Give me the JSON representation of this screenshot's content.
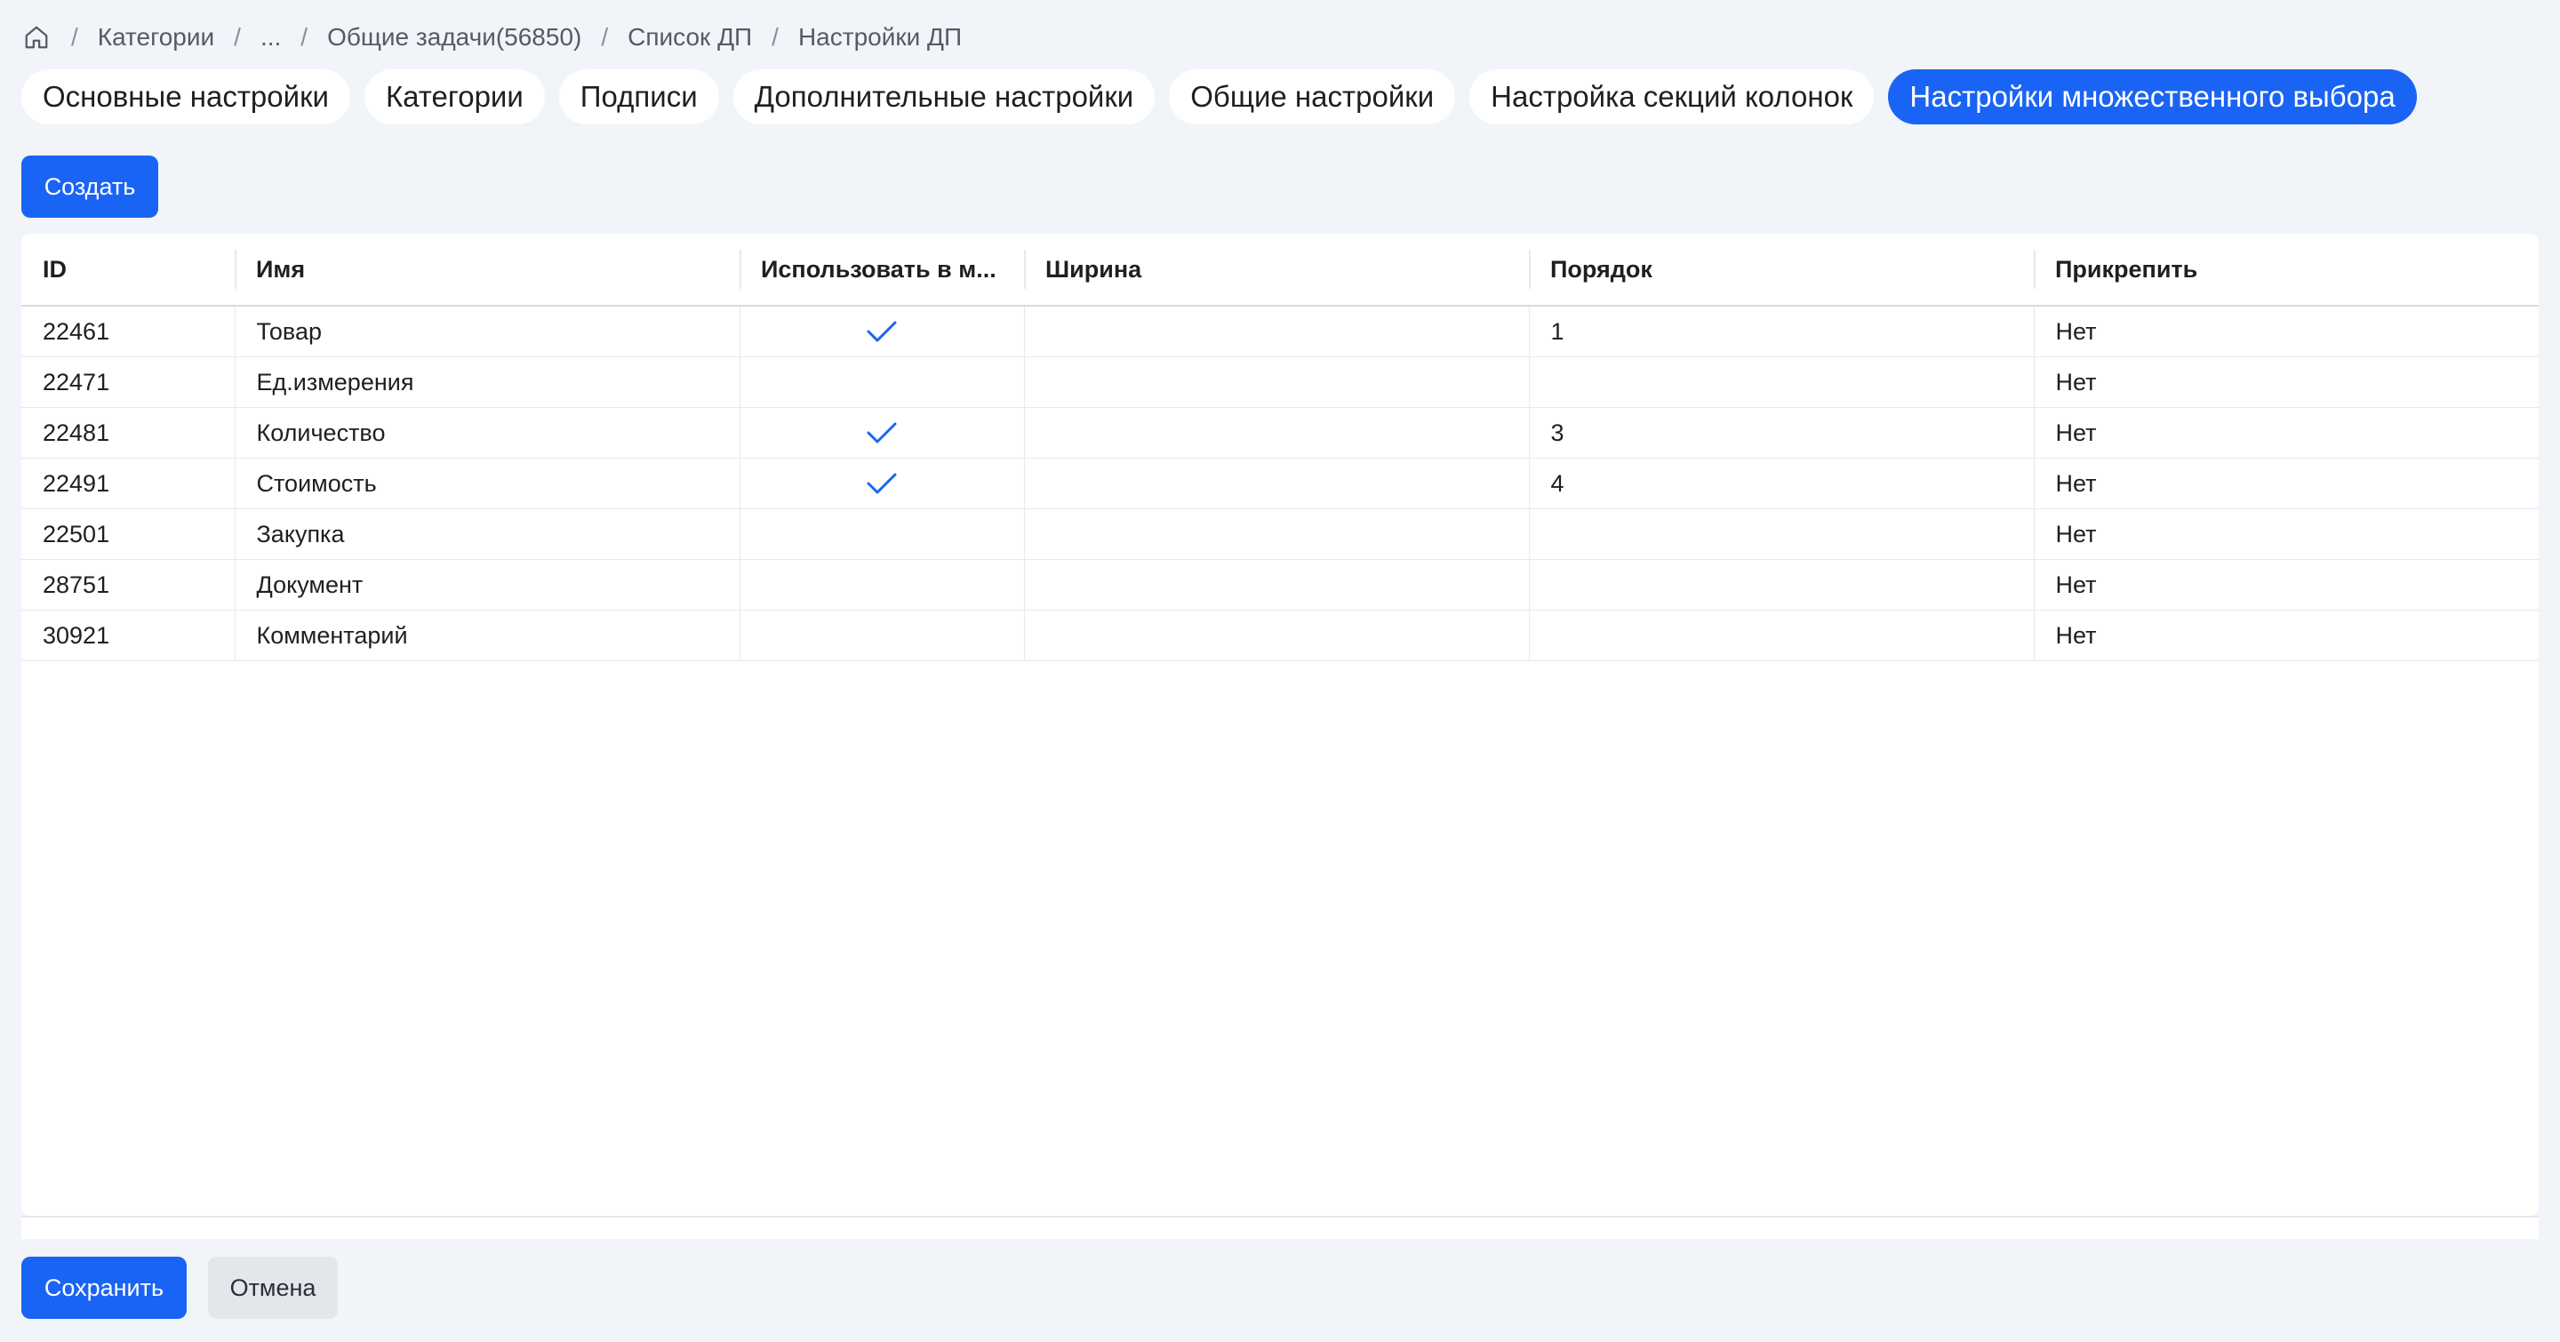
{
  "breadcrumb": {
    "items": [
      "Категории",
      "...",
      "Общие задачи(56850)",
      "Список ДП",
      "Настройки ДП"
    ]
  },
  "tabs": [
    {
      "label": "Основные настройки",
      "active": false
    },
    {
      "label": "Категории",
      "active": false
    },
    {
      "label": "Подписи",
      "active": false
    },
    {
      "label": "Дополнительные настройки",
      "active": false
    },
    {
      "label": "Общие настройки",
      "active": false
    },
    {
      "label": "Настройка секций колонок",
      "active": false
    },
    {
      "label": "Настройки множественного выбора",
      "active": true
    }
  ],
  "toolbar": {
    "create_label": "Создать"
  },
  "table": {
    "columns": [
      "ID",
      "Имя",
      "Использовать в м...",
      "Ширина",
      "Порядок",
      "Прикрепить"
    ],
    "rows": [
      {
        "id": "22461",
        "name": "Товар",
        "use": true,
        "width": "",
        "order": "1",
        "pin": "Нет"
      },
      {
        "id": "22471",
        "name": "Ед.измерения",
        "use": false,
        "width": "",
        "order": "",
        "pin": "Нет"
      },
      {
        "id": "22481",
        "name": "Количество",
        "use": true,
        "width": "",
        "order": "3",
        "pin": "Нет"
      },
      {
        "id": "22491",
        "name": "Стоимость",
        "use": true,
        "width": "",
        "order": "4",
        "pin": "Нет"
      },
      {
        "id": "22501",
        "name": "Закупка",
        "use": false,
        "width": "",
        "order": "",
        "pin": "Нет"
      },
      {
        "id": "28751",
        "name": "Документ",
        "use": false,
        "width": "",
        "order": "",
        "pin": "Нет"
      },
      {
        "id": "30921",
        "name": "Комментарий",
        "use": false,
        "width": "",
        "order": "",
        "pin": "Нет"
      }
    ]
  },
  "footer": {
    "save_label": "Сохранить",
    "cancel_label": "Отмена"
  },
  "colors": {
    "accent": "#1a64f5",
    "background": "#f1f4f8",
    "check": "#1a64f5"
  },
  "icons": {
    "home": "home-icon",
    "check": "check-icon"
  }
}
